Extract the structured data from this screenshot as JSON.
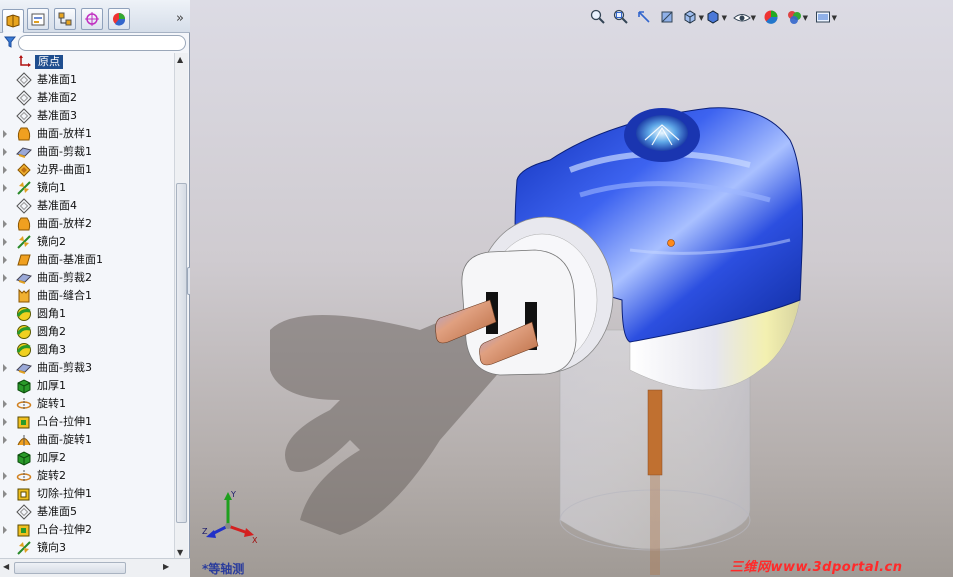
{
  "panel": {
    "tabs": [
      {
        "icon": "feature-manager-icon"
      },
      {
        "icon": "property-manager-icon"
      },
      {
        "icon": "configuration-manager-icon"
      },
      {
        "icon": "dimxpert-manager-icon"
      },
      {
        "icon": "display-manager-icon"
      }
    ],
    "expand_label": "»",
    "filter_icon": "filter-icon",
    "tree": [
      {
        "label": "原点",
        "icon": "origin-icon",
        "expandable": false,
        "selected": true
      },
      {
        "label": "基准面1",
        "icon": "plane-icon",
        "expandable": false
      },
      {
        "label": "基准面2",
        "icon": "plane-icon",
        "expandable": false
      },
      {
        "label": "基准面3",
        "icon": "plane-icon",
        "expandable": false
      },
      {
        "label": "曲面-放样1",
        "icon": "surface-loft-icon",
        "expandable": true
      },
      {
        "label": "曲面-剪裁1",
        "icon": "surface-trim-icon",
        "expandable": true
      },
      {
        "label": "边界-曲面1",
        "icon": "boundary-surface-icon",
        "expandable": true
      },
      {
        "label": "镜向1",
        "icon": "mirror-icon",
        "expandable": true
      },
      {
        "label": "基准面4",
        "icon": "plane-icon",
        "expandable": false
      },
      {
        "label": "曲面-放样2",
        "icon": "surface-loft-icon",
        "expandable": true
      },
      {
        "label": "镜向2",
        "icon": "mirror-icon",
        "expandable": true
      },
      {
        "label": "曲面-基准面1",
        "icon": "planar-surface-icon",
        "expandable": true
      },
      {
        "label": "曲面-剪裁2",
        "icon": "surface-trim-icon",
        "expandable": true
      },
      {
        "label": "曲面-缝合1",
        "icon": "knit-surface-icon",
        "expandable": false
      },
      {
        "label": "圆角1",
        "icon": "fillet-icon",
        "expandable": false
      },
      {
        "label": "圆角2",
        "icon": "fillet-icon",
        "expandable": false
      },
      {
        "label": "圆角3",
        "icon": "fillet-icon",
        "expandable": false
      },
      {
        "label": "曲面-剪裁3",
        "icon": "surface-trim-icon",
        "expandable": true
      },
      {
        "label": "加厚1",
        "icon": "thicken-icon",
        "expandable": false
      },
      {
        "label": "旋转1",
        "icon": "revolve-icon",
        "expandable": true
      },
      {
        "label": "凸台-拉伸1",
        "icon": "boss-extrude-icon",
        "expandable": true
      },
      {
        "label": "曲面-旋转1",
        "icon": "surface-revolve-icon",
        "expandable": true
      },
      {
        "label": "加厚2",
        "icon": "thicken-icon",
        "expandable": false
      },
      {
        "label": "旋转2",
        "icon": "revolve-icon",
        "expandable": true
      },
      {
        "label": "切除-拉伸1",
        "icon": "cut-extrude-icon",
        "expandable": true
      },
      {
        "label": "基准面5",
        "icon": "plane-icon",
        "expandable": false
      },
      {
        "label": "凸台-拉伸2",
        "icon": "boss-extrude-icon",
        "expandable": true
      },
      {
        "label": "镜向3",
        "icon": "mirror-icon",
        "expandable": false
      }
    ]
  },
  "viewport": {
    "toolbar": [
      {
        "icon": "zoom-to-fit-icon"
      },
      {
        "icon": "zoom-to-area-icon"
      },
      {
        "icon": "previous-view-icon"
      },
      {
        "icon": "section-view-icon"
      },
      {
        "icon": "view-orientation-icon"
      },
      {
        "icon": "display-style-icon"
      },
      {
        "icon": "hide-show-items-icon"
      },
      {
        "icon": "edit-appearance-icon"
      },
      {
        "icon": "apply-scene-icon"
      },
      {
        "icon": "view-settings-icon"
      }
    ],
    "view_name": "*等轴测",
    "triad": {
      "x": "X",
      "y": "Y",
      "z": "Z"
    },
    "watermark": "三维网www.3dportal.cn"
  },
  "colors": {
    "model_blue": "#1c3fd0",
    "model_white": "#f0f0f0",
    "prong_copper": "#c8774f",
    "selection": "#1f4e8f",
    "watermark": "#ff2a2a"
  }
}
